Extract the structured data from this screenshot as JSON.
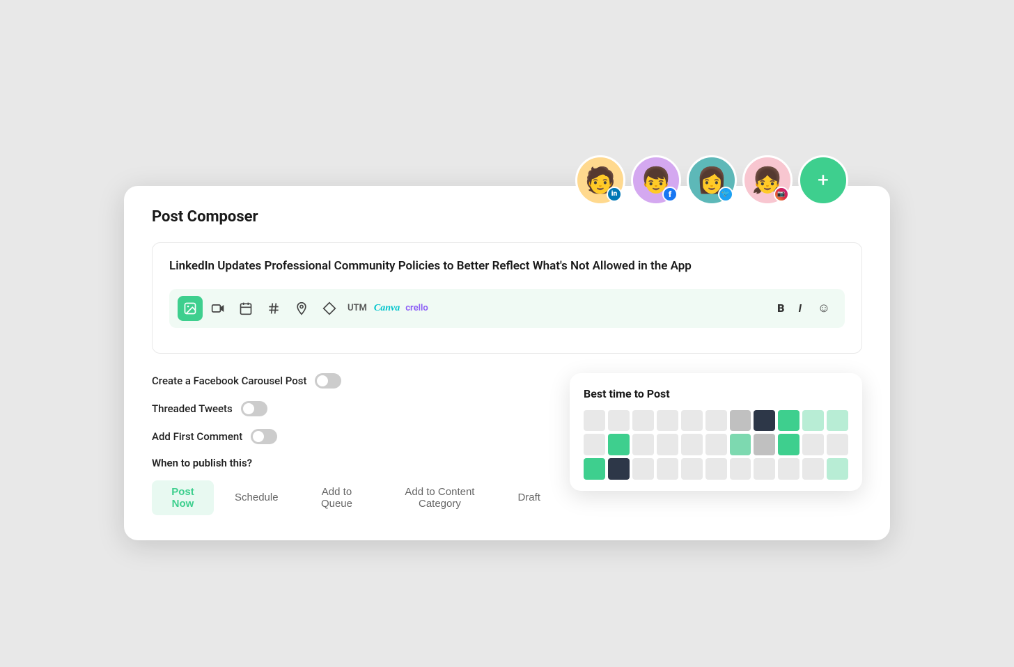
{
  "page": {
    "title": "Post Composer"
  },
  "avatars": [
    {
      "id": "linkedin",
      "bg": "av-yellow",
      "emoji": "🧑",
      "badge": "in",
      "badge_class": "badge-linkedin"
    },
    {
      "id": "facebook",
      "bg": "av-purple",
      "emoji": "👦",
      "badge": "f",
      "badge_class": "badge-facebook"
    },
    {
      "id": "twitter",
      "bg": "av-teal",
      "emoji": "👩",
      "badge": "🐦",
      "badge_class": "badge-twitter"
    },
    {
      "id": "instagram",
      "bg": "av-pink",
      "emoji": "👧",
      "badge": "📷",
      "badge_class": "badge-instagram"
    }
  ],
  "add_button_label": "+",
  "editor": {
    "content": "LinkedIn Updates Professional Community Policies to Better Reflect What's Not Allowed in the App"
  },
  "toolbar": {
    "icons": [
      "image",
      "video",
      "calendar",
      "hash",
      "location",
      "diamond",
      "utm",
      "canva",
      "crello"
    ],
    "right_icons": [
      "bold",
      "italic",
      "emoji"
    ]
  },
  "options": [
    {
      "label": "Create a Facebook Carousel Post",
      "toggled": false
    },
    {
      "label": "Threaded Tweets",
      "toggled": false
    },
    {
      "label": "Add First Comment",
      "toggled": false
    }
  ],
  "when_publish": {
    "label": "When to publish this?",
    "tabs": [
      {
        "label": "Post Now",
        "active": true
      },
      {
        "label": "Schedule",
        "active": false
      },
      {
        "label": "Add to Queue",
        "active": false
      },
      {
        "label": "Add to Content Category",
        "active": false
      },
      {
        "label": "Draft",
        "active": false
      }
    ]
  },
  "best_time": {
    "title": "Best time to Post",
    "grid": [
      "light",
      "light",
      "light",
      "light",
      "light",
      "light",
      "medium",
      "dark",
      "green",
      "light-green",
      "light-green",
      "light",
      "green",
      "light",
      "light",
      "light",
      "light",
      "medium-green",
      "medium",
      "green",
      "light",
      "light",
      "green",
      "dark",
      "light",
      "light",
      "light",
      "light",
      "light",
      "light",
      "light",
      "light",
      "light-green"
    ]
  },
  "colors": {
    "accent_green": "#3ecf8e",
    "light": "#e8e8e8",
    "medium": "#c8c8c8",
    "dark": "#2d3748",
    "green": "#3ecf8e",
    "medium_green": "#7dd9b0",
    "light_green": "#b8edd5"
  }
}
